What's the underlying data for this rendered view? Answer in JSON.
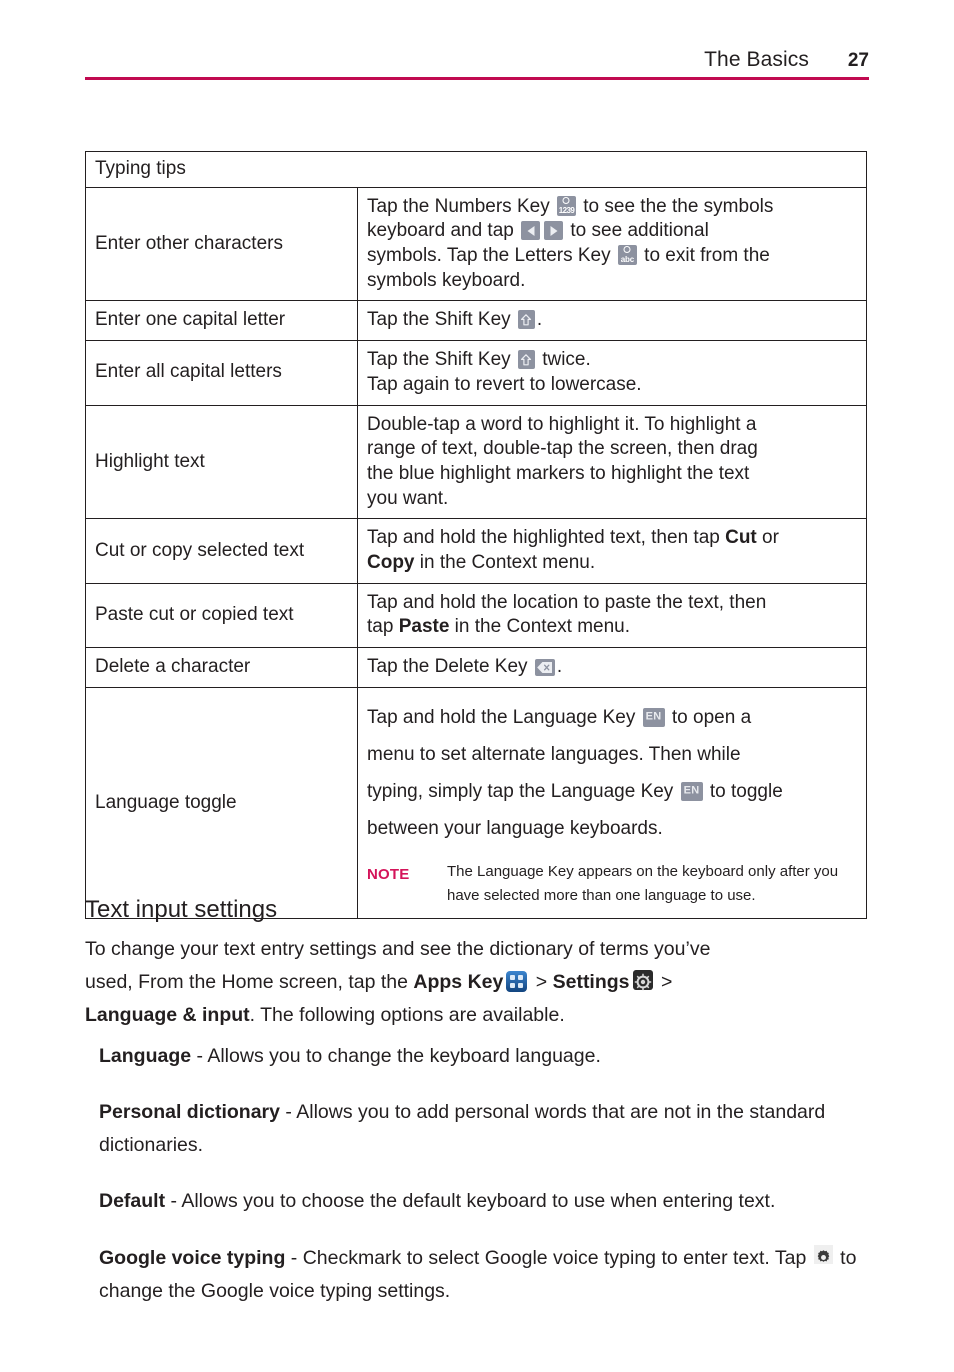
{
  "header": {
    "title": "The Basics",
    "page_number": "27",
    "rule_color": "#c10a50"
  },
  "table": {
    "caption": "Typing tips",
    "rows": [
      {
        "label": "Enter other characters",
        "lines": [
          {
            "pre": "Tap the Numbers Key ",
            "icon": "numbers-key-icon",
            "post": " to see the the symbols"
          },
          {
            "pre": "keyboard and tap ",
            "icon": "arrow-left-key-icon",
            "icon2": "arrow-right-key-icon",
            "post": " to see additional"
          },
          {
            "pre": "symbols. Tap the Letters Key ",
            "icon": "letters-key-icon",
            "post": " to exit from the"
          },
          {
            "pre": "symbols keyboard."
          }
        ]
      },
      {
        "label": "Enter one capital letter",
        "lines": [
          {
            "pre": "Tap the Shift Key ",
            "icon": "shift-key-icon",
            "post": "."
          }
        ]
      },
      {
        "label": "Enter all capital letters",
        "lines": [
          {
            "pre": "Tap the Shift Key ",
            "icon": "shift-key-icon",
            "post": " twice."
          },
          {
            "pre": "Tap again to revert to lowercase."
          }
        ]
      },
      {
        "label": "Highlight text",
        "lines": [
          {
            "pre": "Double-tap a word to highlight it. To highlight a"
          },
          {
            "pre": "range of text, double-tap the screen, then drag"
          },
          {
            "pre": "the blue highlight markers to highlight the text"
          },
          {
            "pre": "you want."
          }
        ]
      },
      {
        "label": "Cut or copy selected text",
        "lines": [
          {
            "pre": "Tap and hold the highlighted text, then tap ",
            "bold": "Cut",
            "post": " or"
          },
          {
            "bold": "Copy",
            "post": " in the Context menu."
          }
        ]
      },
      {
        "label": "Paste cut or copied text",
        "lines": [
          {
            "pre": "Tap and hold the location to paste the text, then"
          },
          {
            "pre": "tap ",
            "bold": "Paste",
            "post": " in the Context menu."
          }
        ]
      },
      {
        "label": "Delete a character",
        "lines": [
          {
            "pre": "Tap the Delete Key ",
            "icon": "delete-key-icon",
            "post": "."
          }
        ]
      },
      {
        "label": "Language toggle",
        "lines": [
          {
            "pre": "Tap and hold the Language Key ",
            "icon": "language-key-icon",
            "post": " to open a"
          },
          {
            "pre": "menu to set alternate languages. Then while"
          },
          {
            "pre": "typing, simply tap the Language Key ",
            "icon": "language-key-icon",
            "post": " to toggle"
          },
          {
            "pre": "between your language keyboards."
          }
        ],
        "note": {
          "label": "NOTE",
          "text": "The Language Key appears on the keyboard only after you have selected more than one language to use."
        }
      }
    ]
  },
  "section": {
    "heading": "Text input settings",
    "intro": {
      "l1": "To change your text entry settings and see the dictionary of terms you’ve",
      "l2_pre": "used, From the Home screen, tap the ",
      "l2_b1": "Apps Key",
      "l2_mid": " > ",
      "l2_b2": "Settings",
      "l2_end": " > ",
      "l3_b": "Language & input",
      "l3_post": ". The following options are available."
    },
    "options": [
      {
        "term": "Language",
        "desc": " - Allows you to change the keyboard language."
      },
      {
        "term": "Personal dictionary",
        "desc": " - Allows you to add personal words that are not in the standard dictionaries."
      },
      {
        "term": "Default",
        "desc": " - Allows you to choose the default keyboard to use when entering text."
      },
      {
        "term": "Google voice typing",
        "desc_pre": " - Checkmark to select Google voice typing to enter text. Tap ",
        "desc_post": " to change the Google voice typing settings."
      }
    ]
  },
  "icons": {
    "numbers_key_label": "1239",
    "letters_key_label": "abc",
    "language_key_label": "EN"
  },
  "colors": {
    "accent": "#c10a50",
    "note": "#d4145a",
    "key_gray": "#8d92a0",
    "apps_blue": "#1d5fa8",
    "text": "#231f20"
  }
}
